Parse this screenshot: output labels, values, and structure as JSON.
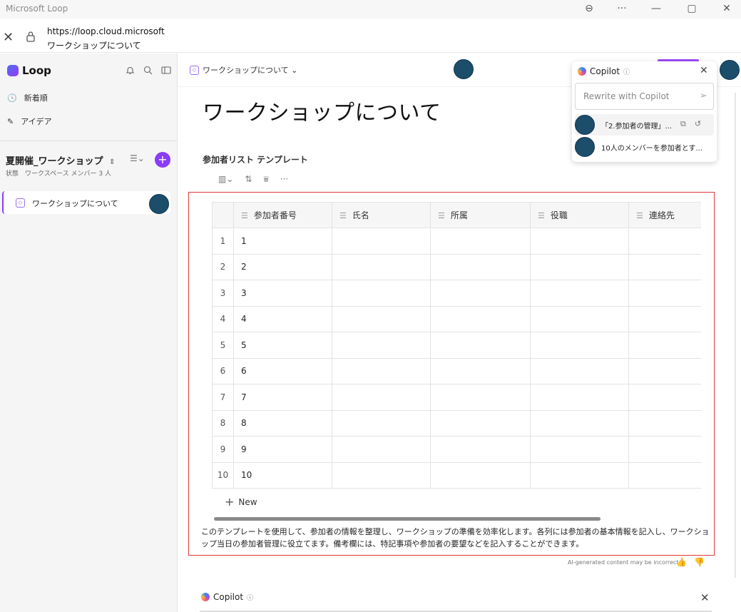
{
  "window": {
    "title": "Microsoft Loop",
    "controls": {
      "zoom": "⊖",
      "more": "···",
      "minimize": "—",
      "maximize": "▢",
      "close": "✕"
    }
  },
  "address": {
    "close": "✕",
    "url": "https://loop.cloud.microsoft",
    "page_title": "ワークショップについて"
  },
  "sidebar": {
    "app_name": "Loop",
    "icons": [
      "bell-icon",
      "search-icon",
      "panel-icon"
    ],
    "nav": [
      {
        "icon": "🕓",
        "label": "新着順"
      },
      {
        "icon": "✎",
        "label": "アイデア"
      }
    ],
    "workspace": {
      "name": "夏開催_ワークショップ",
      "status": "状態　ワークスペース メンバー 3 人",
      "sort_icon": "☰⌄",
      "add_label": "+"
    },
    "pages": [
      {
        "label": "ワークショップについて"
      }
    ]
  },
  "main": {
    "breadcrumb": "ワークショップについて ⌄",
    "title": "ワークショップについて",
    "section_label": "参加者リスト テンプレート",
    "toolbar": {
      "view": "▥⌄",
      "sort": "⇅",
      "filter": "⩸",
      "more": "···"
    },
    "table": {
      "columns": [
        "参加者番号",
        "氏名",
        "所属",
        "役職",
        "連絡先"
      ],
      "rows": [
        {
          "num": "1",
          "values": [
            "1",
            "",
            "",
            "",
            ""
          ]
        },
        {
          "num": "2",
          "values": [
            "2",
            "",
            "",
            "",
            ""
          ]
        },
        {
          "num": "3",
          "values": [
            "3",
            "",
            "",
            "",
            ""
          ]
        },
        {
          "num": "4",
          "values": [
            "4",
            "",
            "",
            "",
            ""
          ]
        },
        {
          "num": "5",
          "values": [
            "5",
            "",
            "",
            "",
            ""
          ]
        },
        {
          "num": "6",
          "values": [
            "6",
            "",
            "",
            "",
            ""
          ]
        },
        {
          "num": "7",
          "values": [
            "7",
            "",
            "",
            "",
            ""
          ]
        },
        {
          "num": "8",
          "values": [
            "8",
            "",
            "",
            "",
            ""
          ]
        },
        {
          "num": "9",
          "values": [
            "9",
            "",
            "",
            "",
            ""
          ]
        },
        {
          "num": "10",
          "values": [
            "10",
            "",
            "",
            "",
            ""
          ]
        }
      ],
      "new_label": "New",
      "new_icon": "+"
    },
    "description": "このテンプレートを使用して、参加者の情報を整理し、ワークショップの準備を効率化します。各列には参加者の基本情報を記入し、ワークショップ当日の参加者管理に役立てます。備考欄には、特記事項や参加者の要望などを記入することができます。",
    "ai_note": "AI-generated content may be incorrect",
    "feedback": {
      "like": "👍",
      "dislike": "👎"
    }
  },
  "copilot_popover": {
    "title": "Copilot",
    "info": "ⓘ",
    "close": "✕",
    "placeholder": "Rewrite with Copilot",
    "send": "➢",
    "suggestions": [
      {
        "text": "「2.参加者の管理」..."
      },
      {
        "text": "10人のメンバーを参加者とす..."
      }
    ],
    "suggestion_actions": {
      "copy": "⧉",
      "undo": "↺"
    }
  },
  "copilot_bottom": {
    "title": "Copilot",
    "info": "ⓘ",
    "close": "✕"
  },
  "colors": {
    "accent": "#8b3cf7",
    "highlight_border": "#e0393b",
    "avatar": "#1c4d6b"
  }
}
